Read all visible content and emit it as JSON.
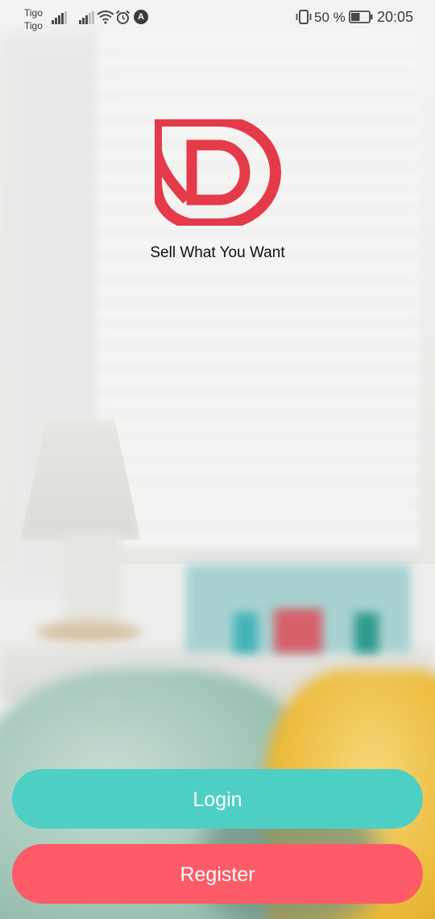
{
  "status_bar": {
    "carrier_1": "Tigo",
    "carrier_2": "Tigo",
    "battery_percent": "50 %",
    "time": "20:05",
    "nav_badge": "A",
    "icons": [
      "signal-icon",
      "signal-icon",
      "wifi-icon",
      "alarm-icon",
      "navigation-badge-icon",
      "vibrate-icon",
      "battery-icon"
    ],
    "battery_level": 0.5
  },
  "brand": {
    "tagline": "Sell What You Want",
    "logo_color": "#e53a4a"
  },
  "actions": {
    "login_label": "Login",
    "register_label": "Register",
    "login_color": "#4ecfc4",
    "register_color": "#fd5b67"
  }
}
